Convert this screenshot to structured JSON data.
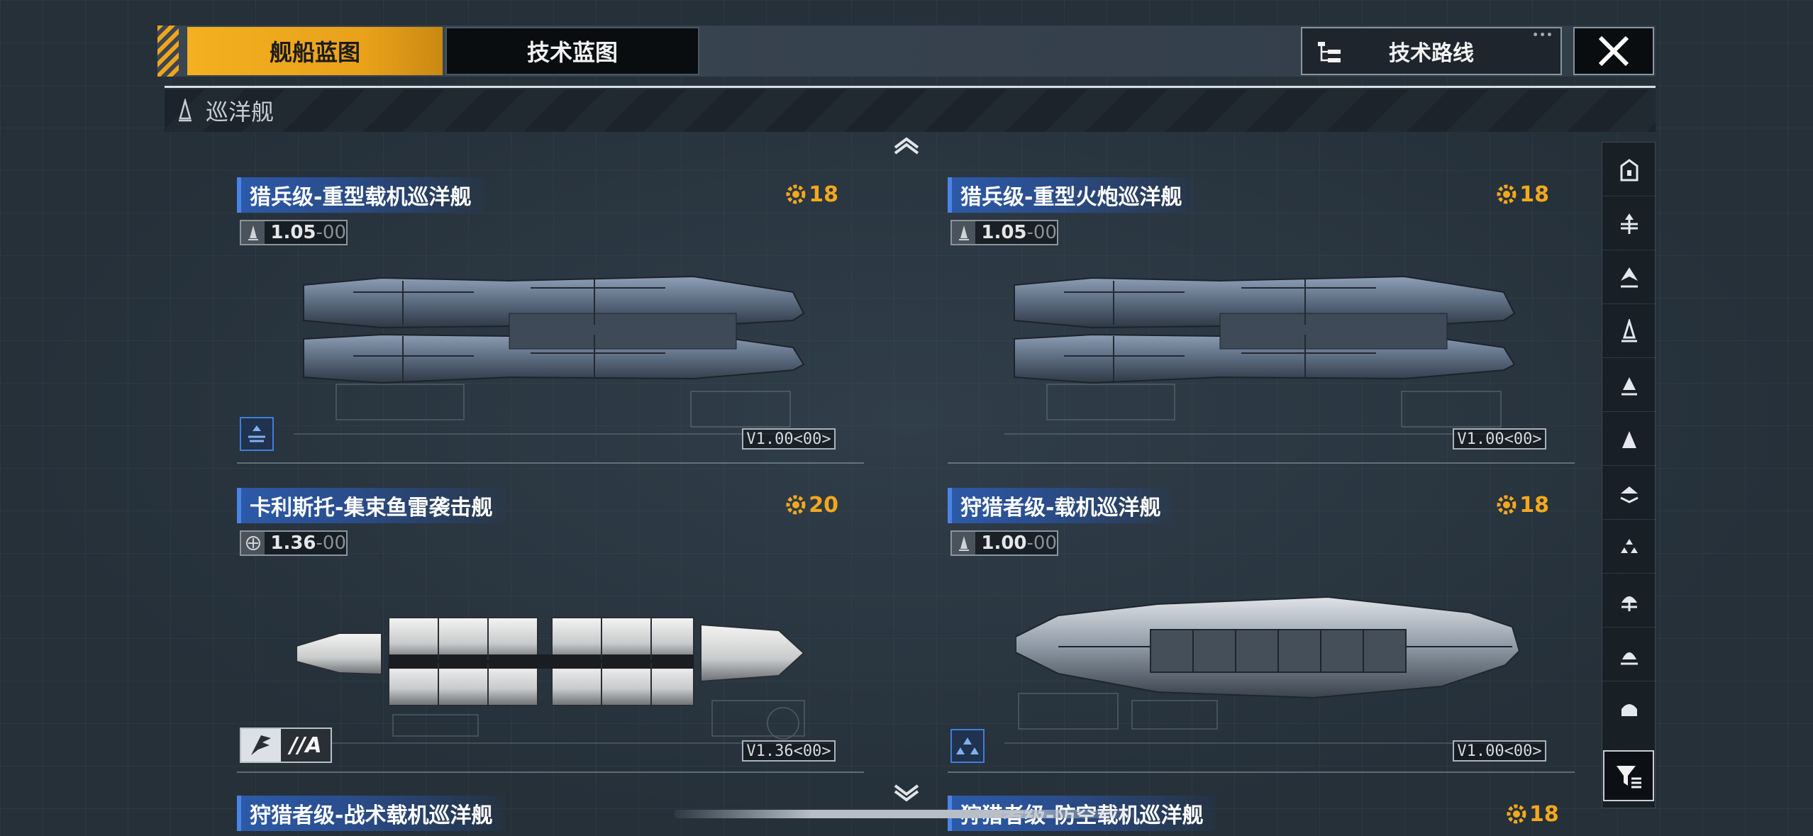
{
  "tabs": {
    "ship_blueprint": "舰船蓝图",
    "tech_blueprint": "技术蓝图"
  },
  "tech_route_label": "技术路线",
  "category": {
    "label": "巡洋舰",
    "icon": "cruiser-icon"
  },
  "cards": [
    {
      "name": "猎兵级-重型载机巡洋舰",
      "cost": "18",
      "version_main": "1.05",
      "version_sub": "-00",
      "version_tag": "V1.00<00>",
      "type_icon": "carrier-type-icon",
      "hull": "dark"
    },
    {
      "name": "猎兵级-重型火炮巡洋舰",
      "cost": "18",
      "version_main": "1.05",
      "version_sub": "-00",
      "version_tag": "V1.00<00>",
      "type_icon": "",
      "hull": "dark"
    },
    {
      "name": "卡利斯托-集束鱼雷袭击舰",
      "cost": "20",
      "version_main": "1.36",
      "version_sub": "-00",
      "version_tag": "V1.36<00>",
      "rank": "//A",
      "hull": "white"
    },
    {
      "name": "狩猎者级-载机巡洋舰",
      "cost": "18",
      "version_main": "1.00",
      "version_sub": "-00",
      "version_tag": "V1.00<00>",
      "type_icon": "fighter-type-icon",
      "hull": "grey"
    }
  ],
  "partial_cards": [
    {
      "name": "狩猎者级-战术载机巡洋舰"
    },
    {
      "name": "狩猎者级-防空载机巡洋舰",
      "cost": "18"
    }
  ],
  "sidebar_icons": [
    "battleship-icon",
    "carrier-icon",
    "battlecruiser-icon",
    "cruiser-icon",
    "destroyer-icon",
    "frigate-icon",
    "corvette-icon",
    "fighter-icon",
    "station-icon",
    "support-icon",
    "auxiliary-icon"
  ],
  "accent_color": "#f4b020",
  "cost_color": "#f3a81c"
}
